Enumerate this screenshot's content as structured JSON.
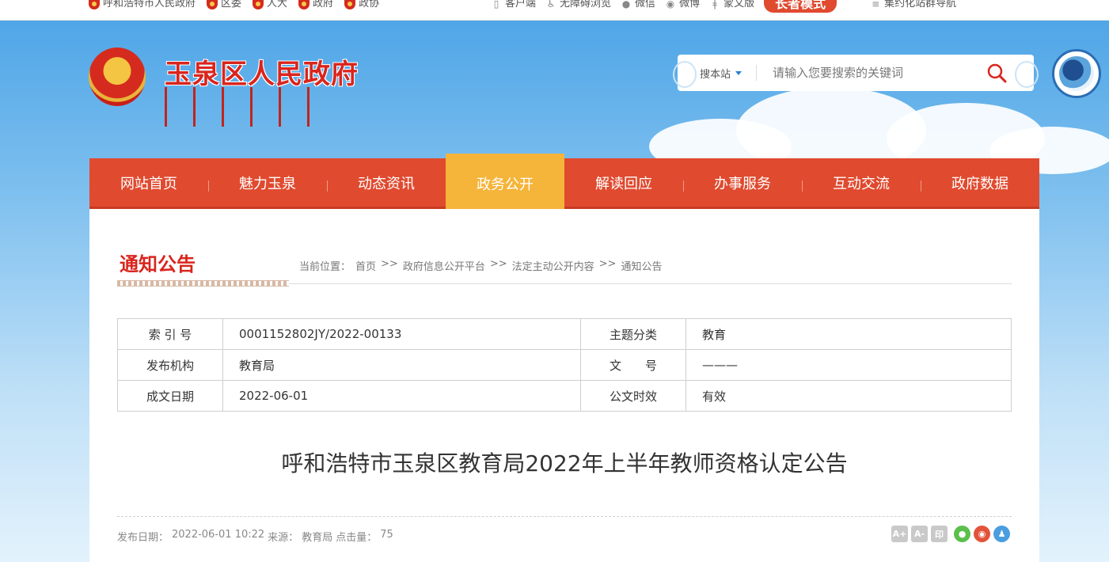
{
  "topbar": {
    "left_links": [
      "呼和浩特市人民政府",
      "区委",
      "人大",
      "政府",
      "政协"
    ],
    "client": "客户端",
    "accessible": "无障碍浏览",
    "wechat": "微信",
    "weibo": "微博",
    "mongolian": "蒙文版",
    "elder_mode": "长者模式",
    "site_nav": "集约化站群导航"
  },
  "header": {
    "site_title": "玉泉区人民政府",
    "search": {
      "scope": "搜本站",
      "placeholder": "请输入您要搜索的关键词"
    }
  },
  "nav": {
    "items": [
      "网站首页",
      "魅力玉泉",
      "动态资讯",
      "政务公开",
      "解读回应",
      "办事服务",
      "互动交流",
      "政府数据"
    ],
    "active": "政务公开"
  },
  "section": {
    "title": "通知公告",
    "breadcrumb": {
      "label": "当前位置：",
      "items": [
        "首页",
        "政府信息公开平台",
        "法定主动公开内容",
        "通知公告"
      ],
      "sep": ">>"
    }
  },
  "meta_table": {
    "rows": [
      {
        "k1": "索 引 号",
        "v1": "0001152802JY/2022-00133",
        "k2": "主题分类",
        "v2": "教育"
      },
      {
        "k1": "发布机构",
        "v1": "教育局",
        "k2": "文　　号",
        "v2": "———"
      },
      {
        "k1": "成文日期",
        "v1": "2022-06-01",
        "k2": "公文时效",
        "v2": "有效"
      }
    ]
  },
  "article": {
    "title": "呼和浩特市玉泉区教育局2022年上半年教师资格认定公告",
    "publish_label": "发布日期：",
    "publish_date": "2022-06-01 10:22",
    "source_label": "来源：",
    "source": "教育局",
    "clicks_label": "点击量：",
    "clicks": "75"
  },
  "tools": {
    "font_up": "A+",
    "font_down": "A-",
    "print": "印"
  }
}
